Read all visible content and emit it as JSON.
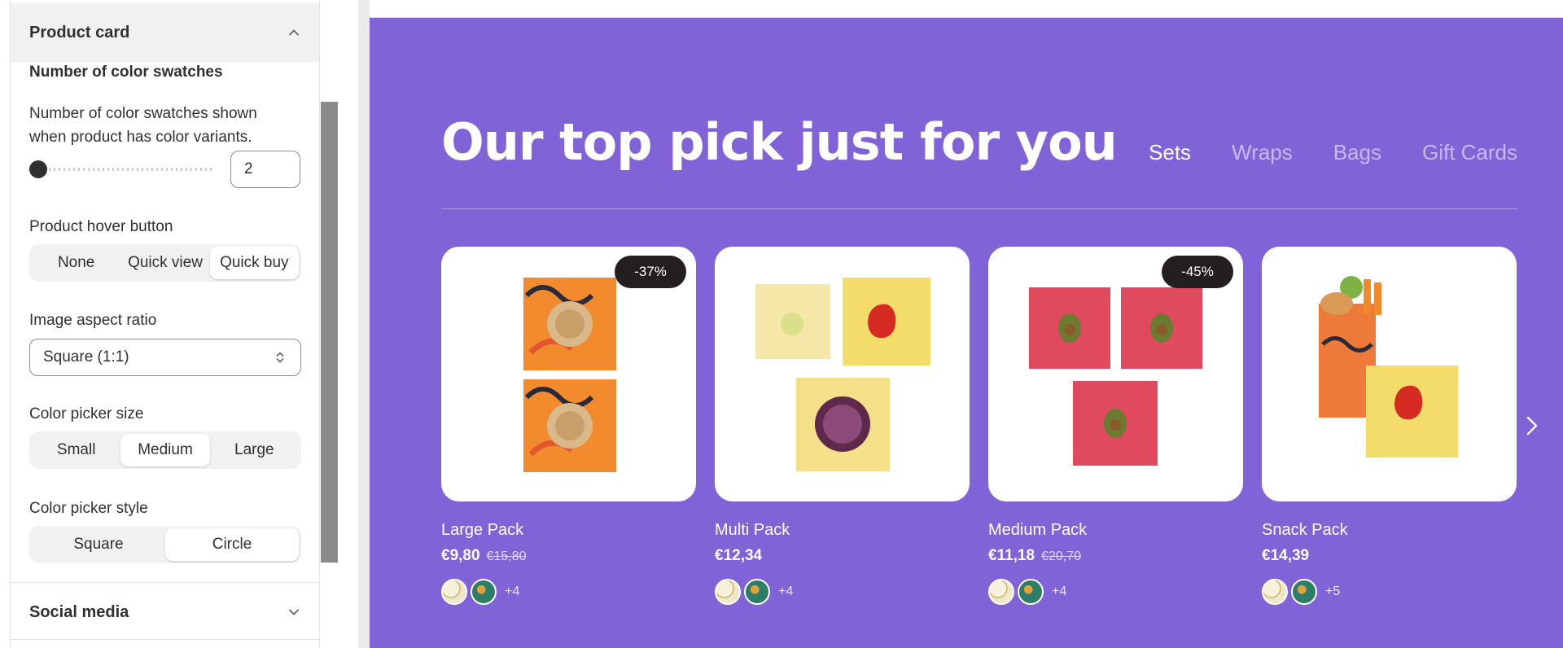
{
  "sidebar": {
    "product_card": {
      "title": "Product card"
    },
    "swatches": {
      "heading": "Number of color swatches",
      "description_line1": "Number of color swatches shown",
      "description_line2": "when product has color variants.",
      "value": "2"
    },
    "hover_button": {
      "label": "Product hover button",
      "options": [
        "None",
        "Quick view",
        "Quick buy"
      ],
      "selected": "Quick buy"
    },
    "aspect_ratio": {
      "label": "Image aspect ratio",
      "value": "Square (1:1)"
    },
    "picker_size": {
      "label": "Color picker size",
      "options": [
        "Small",
        "Medium",
        "Large"
      ],
      "selected": "Medium"
    },
    "picker_style": {
      "label": "Color picker style",
      "options": [
        "Square",
        "Circle"
      ],
      "selected": "Circle"
    },
    "social_media": {
      "title": "Social media"
    }
  },
  "preview": {
    "headline": "Our top pick just for you",
    "tabs": [
      "Sets",
      "Wraps",
      "Bags",
      "Gift Cards"
    ],
    "active_tab": "Sets",
    "products": [
      {
        "name": "Large Pack",
        "price": "€9,80",
        "old_price": "€15,80",
        "badge": "-37%",
        "more_swatches": "+4"
      },
      {
        "name": "Multi Pack",
        "price": "€12,34",
        "old_price": "",
        "badge": "",
        "more_swatches": "+4"
      },
      {
        "name": "Medium Pack",
        "price": "€11,18",
        "old_price": "€20,70",
        "badge": "-45%",
        "more_swatches": "+4"
      },
      {
        "name": "Snack Pack",
        "price": "€14,39",
        "old_price": "",
        "badge": "",
        "more_swatches": "+5"
      }
    ]
  },
  "colors": {
    "preview_bg": "#8163d8",
    "badge_bg": "#231f20",
    "panel_bg": "#ffffff"
  }
}
